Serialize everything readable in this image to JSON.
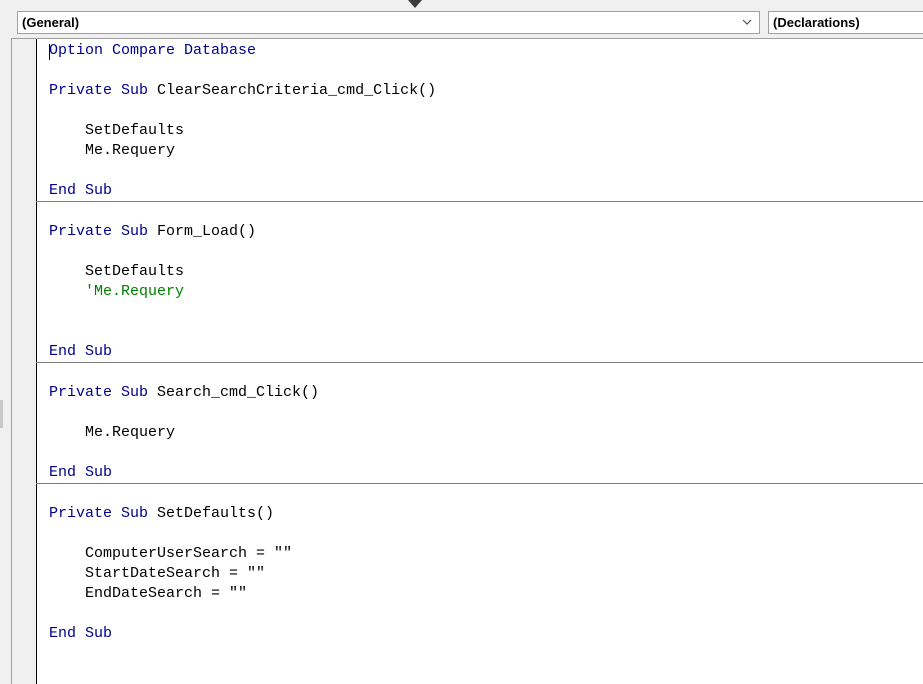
{
  "combos": {
    "object": "(General)",
    "procedure": "(Declarations)"
  },
  "icons": {
    "dropdown": "chevron-down-icon",
    "splitter": "splitter-grip-icon"
  },
  "colors": {
    "keyword": "#00008b",
    "comment": "#008000",
    "text": "#000000"
  },
  "code": {
    "l1": {
      "kw": "Option Compare Database"
    },
    "l2": {
      "kw": "Private Sub",
      "text": " ClearSearchCriteria_cmd_Click()"
    },
    "l3": {
      "text": "    SetDefaults"
    },
    "l4": {
      "text": "    Me.Requery"
    },
    "l5": {
      "kw": "End Sub"
    },
    "l6": {
      "kw": "Private Sub",
      "text": " Form_Load()"
    },
    "l7": {
      "text": "    SetDefaults"
    },
    "l8": {
      "comment": "    'Me.Requery"
    },
    "l9": {
      "kw": "End Sub"
    },
    "l10": {
      "kw": "Private Sub",
      "text": " Search_cmd_Click()"
    },
    "l11": {
      "text": "    Me.Requery"
    },
    "l12": {
      "kw": "End Sub"
    },
    "l13": {
      "kw": "Private Sub",
      "text": " SetDefaults()"
    },
    "l14": {
      "text": "    ComputerUserSearch = \"\""
    },
    "l15": {
      "text": "    StartDateSearch = \"\""
    },
    "l16": {
      "text": "    EndDateSearch = \"\""
    },
    "l17": {
      "kw": "End Sub"
    }
  }
}
